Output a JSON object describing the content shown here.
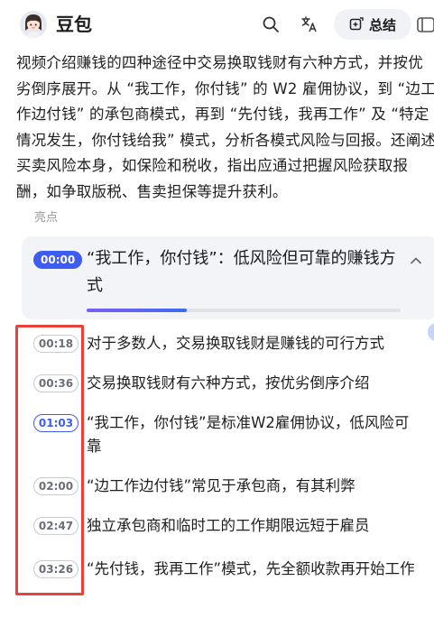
{
  "header": {
    "app_title": "豆包",
    "avatar_icon": "avatar-girl",
    "search_icon": "search-icon",
    "translate_icon": "translate-icon",
    "summary_button_label": "总结",
    "summary_button_icon": "summary-icon",
    "edge_icon": "sidebar-icon"
  },
  "summary": {
    "text": "视频介绍赚钱的四种途径中交易换取钱财有六种方式，并按优劣倒序展开。从 “我工作，你付钱” 的 W2 雇佣协议，到 “边工作边付钱” 的承包商模式，再到 “先付钱，我再工作” 及 “特定情况发生，你付钱给我” 模式，分析各模式风险与回报。还阐述买卖风险本身，如保险和税收，指出应通过把握风险获取报酬，如争取版税、售卖担保等提升获利。"
  },
  "highlights": {
    "label": "亮点",
    "active": {
      "time": "00:00",
      "title": "“我工作，你付钱”：低风险但可靠的赚钱方式",
      "progress": 0.32
    },
    "items": [
      {
        "time": "00:18",
        "text": "对于多数人，交易换取钱财是赚钱的可行方式"
      },
      {
        "time": "00:36",
        "text": "交易换取钱财有六种方式，按优劣倒序介绍"
      },
      {
        "time": "01:03",
        "text": "“我工作，你付钱”是标准W2雇佣协议，低风险可靠"
      },
      {
        "time": "02:00",
        "text": "“边工作边付钱”常见于承包商，有其利弊"
      },
      {
        "time": "02:47",
        "text": "独立承包商和临时工的工作期限远短于雇员"
      },
      {
        "time": "03:26",
        "text": "“先付钱，我再工作”模式，先全额收款再开始工作"
      }
    ]
  },
  "colors": {
    "accent": "#3f5cf1",
    "annotation_box": "#e8423c"
  }
}
